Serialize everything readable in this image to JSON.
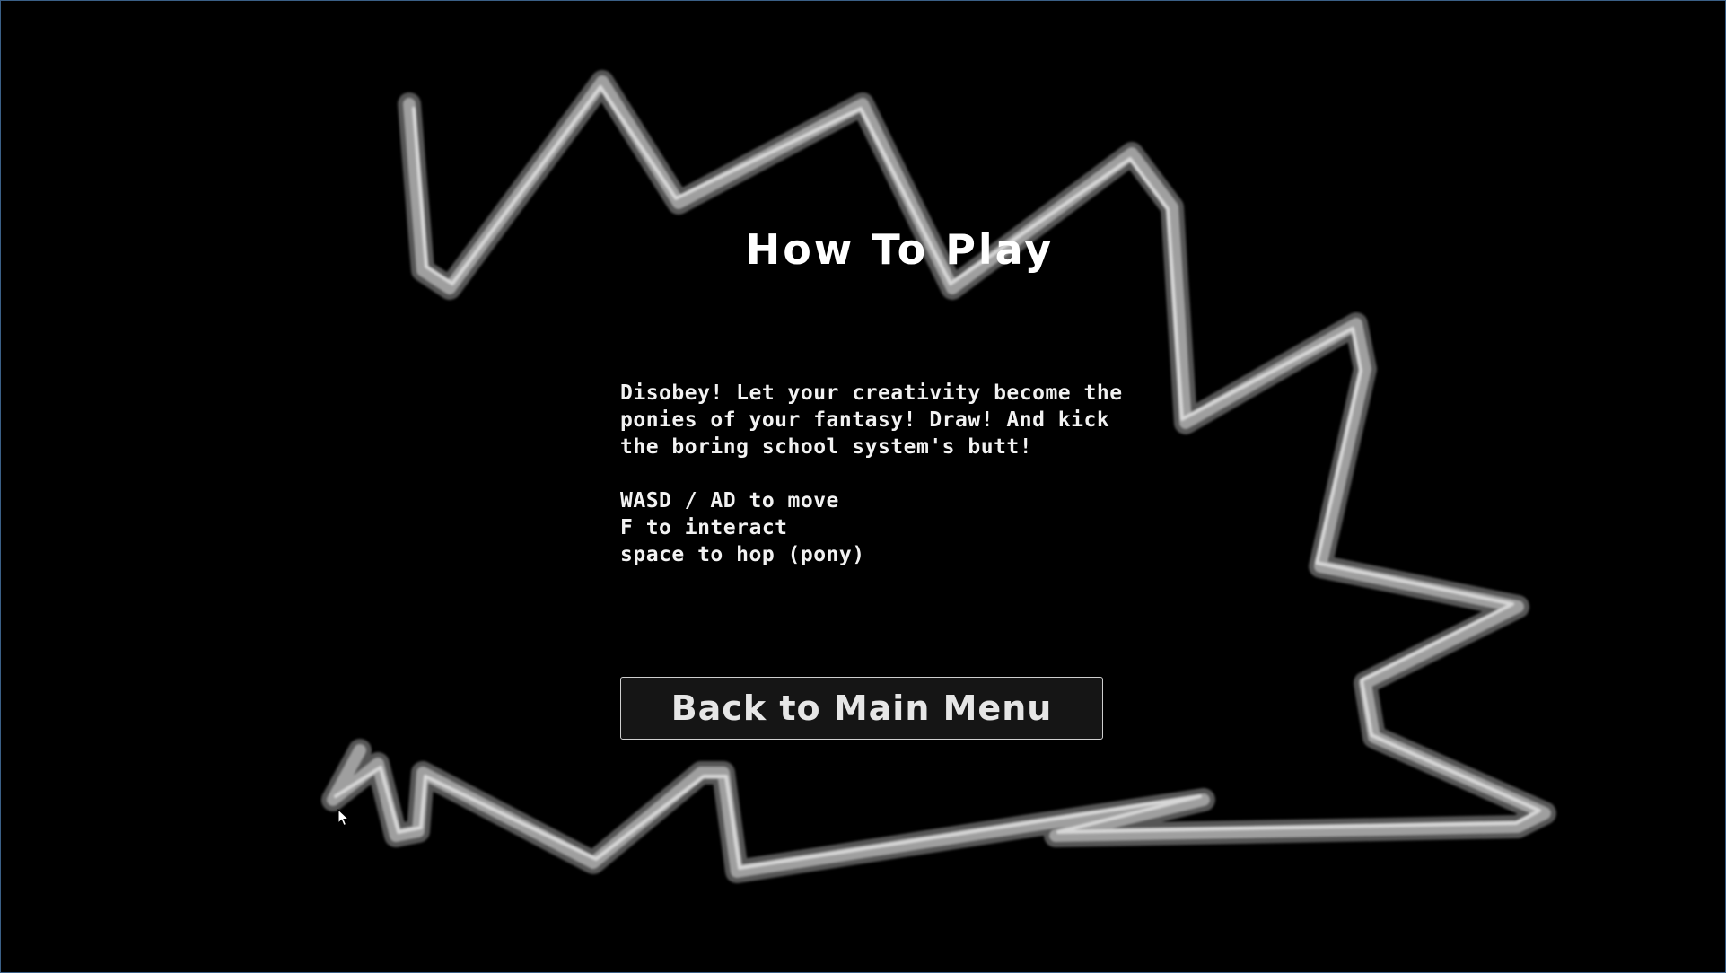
{
  "screen": {
    "title": "How To Play",
    "description": "Disobey! Let your creativity become the\nponies of your fantasy! Draw! And kick\nthe boring school system's butt!",
    "controls": [
      "WASD / AD to move",
      "F to interact",
      "space to hop (pony)"
    ],
    "back_button_label": "Back to Main Menu"
  },
  "colors": {
    "background": "#000000",
    "text": "#ffffff",
    "scribble": "#bdbdbd",
    "button_bg": "#151515",
    "button_border": "#cfcfcf"
  },
  "icons": {
    "cursor": "mouse-pointer-icon"
  }
}
